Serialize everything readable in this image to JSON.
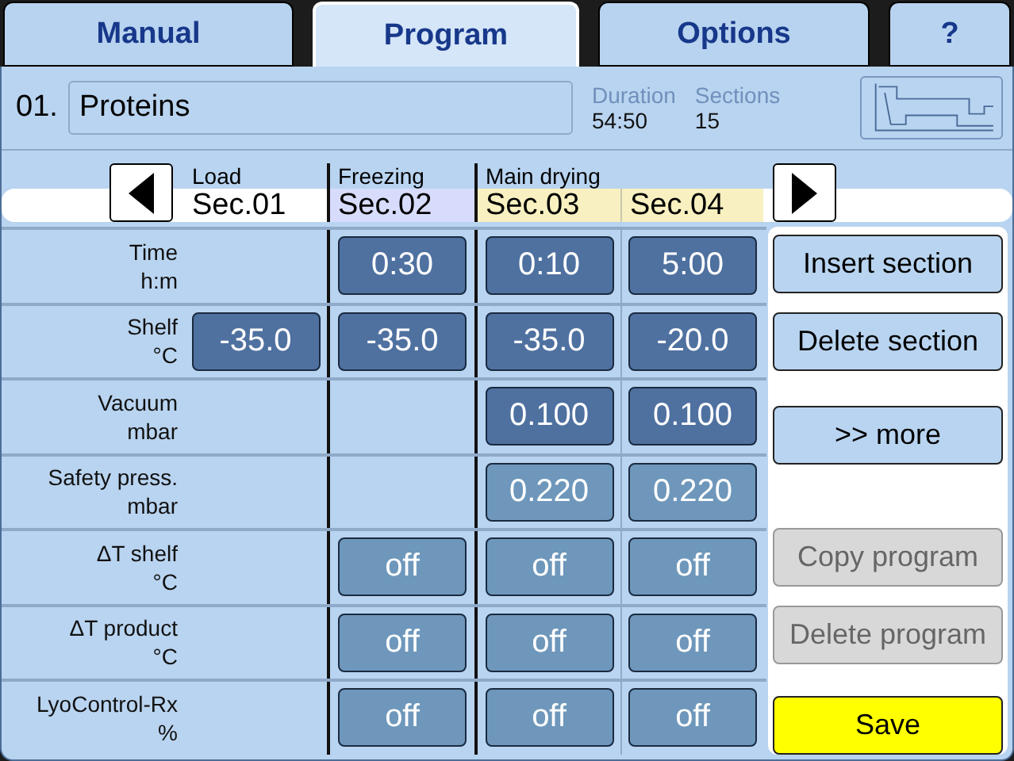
{
  "tabs": [
    {
      "label": "Manual",
      "selected": false
    },
    {
      "label": "Program",
      "selected": true
    },
    {
      "label": "Options",
      "selected": false
    },
    {
      "label": "?",
      "selected": false
    }
  ],
  "program": {
    "number": "01.",
    "name": "Proteins",
    "duration_label": "Duration",
    "duration": "54:50",
    "sections_label": "Sections",
    "sections": "15"
  },
  "phases": [
    {
      "label": "Load",
      "sections": [
        {
          "label": "Sec.01",
          "color": "#ffffff"
        }
      ]
    },
    {
      "label": "Freezing",
      "sections": [
        {
          "label": "Sec.02",
          "color": "#d8dcfc"
        }
      ]
    },
    {
      "label": "Main drying",
      "sections": [
        {
          "label": "Sec.03",
          "color": "#f8f0c0"
        },
        {
          "label": "Sec.04",
          "color": "#f8f0c0"
        }
      ]
    }
  ],
  "rows": [
    {
      "label": "Time",
      "unit": "h:m",
      "cells": [
        null,
        {
          "value": "0:30",
          "kind": "set"
        },
        {
          "value": "0:10",
          "kind": "set"
        },
        {
          "value": "5:00",
          "kind": "set"
        }
      ]
    },
    {
      "label": "Shelf",
      "unit": "°C",
      "cells": [
        {
          "value": "-35.0",
          "kind": "set"
        },
        {
          "value": "-35.0",
          "kind": "set"
        },
        {
          "value": "-35.0",
          "kind": "set"
        },
        {
          "value": "-20.0",
          "kind": "set"
        }
      ]
    },
    {
      "label": "Vacuum",
      "unit": "mbar",
      "cells": [
        null,
        null,
        {
          "value": "0.100",
          "kind": "set"
        },
        {
          "value": "0.100",
          "kind": "set"
        }
      ]
    },
    {
      "label": "Safety press.",
      "unit": "mbar",
      "cells": [
        null,
        null,
        {
          "value": "0.220",
          "kind": "optional"
        },
        {
          "value": "0.220",
          "kind": "optional"
        }
      ]
    },
    {
      "label": "ΔT shelf",
      "unit": "°C",
      "cells": [
        null,
        {
          "value": "off",
          "kind": "optional"
        },
        {
          "value": "off",
          "kind": "optional"
        },
        {
          "value": "off",
          "kind": "optional"
        }
      ]
    },
    {
      "label": "ΔT product",
      "unit": "°C",
      "cells": [
        null,
        {
          "value": "off",
          "kind": "optional"
        },
        {
          "value": "off",
          "kind": "optional"
        },
        {
          "value": "off",
          "kind": "optional"
        }
      ]
    },
    {
      "label": "LyoControl-Rx",
      "unit": "%",
      "cells": [
        null,
        {
          "value": "off",
          "kind": "optional"
        },
        {
          "value": "off",
          "kind": "optional"
        },
        {
          "value": "off",
          "kind": "optional"
        }
      ]
    }
  ],
  "actions": [
    {
      "label": "Insert section",
      "kind": "normal",
      "disabled": false
    },
    {
      "label": "Delete section",
      "kind": "normal",
      "disabled": false
    },
    {
      "label": ">> more",
      "kind": "normal",
      "disabled": false
    },
    {
      "label": "Copy program",
      "kind": "normal",
      "disabled": true
    },
    {
      "label": "Delete program",
      "kind": "normal",
      "disabled": true
    },
    {
      "label": "Save",
      "kind": "primary",
      "disabled": false
    }
  ]
}
